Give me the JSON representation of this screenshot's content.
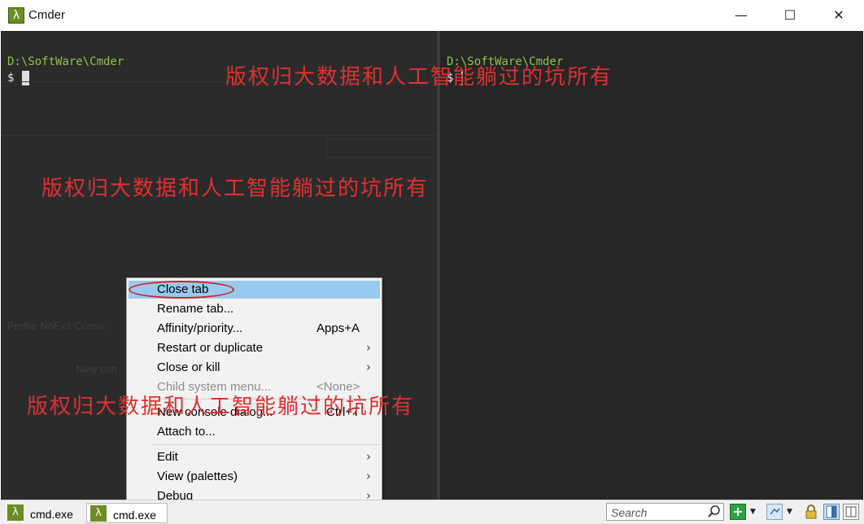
{
  "window": {
    "title": "Cmder",
    "app_icon_glyph": "λ",
    "buttons": {
      "minimize": "—",
      "maximize": "☐",
      "close": "✕"
    }
  },
  "consoles": {
    "left": {
      "path": "D:\\SoftWare\\Cmder",
      "prompt": "$"
    },
    "right": {
      "path": "D:\\SoftWare\\Cmder",
      "prompt": "$"
    }
  },
  "ghost_text": {
    "row1": "Profile   NoExit   Conso",
    "row2": "New con"
  },
  "watermarks": {
    "wm1": "版权归大数据和人工智能躺过的坑所有",
    "wm2": "版权归大数据和人工智能躺过的坑所有",
    "wm3": "版权归大数据和人工智能躺过的坑所有"
  },
  "context_menu": {
    "items": [
      {
        "label": "Close tab",
        "shortcut": "",
        "submenu": false
      },
      {
        "label": "Rename tab...",
        "shortcut": "",
        "submenu": false
      },
      {
        "label": "Affinity/priority...",
        "shortcut": "Apps+A",
        "submenu": false
      },
      {
        "label": "Restart or duplicate",
        "shortcut": "",
        "submenu": true
      },
      {
        "label": "Close or kill",
        "shortcut": "",
        "submenu": true
      },
      {
        "label": "Child system menu...",
        "shortcut": "<None>",
        "submenu": false
      },
      {
        "label": "New console dialog...",
        "shortcut": "Ctrl+T",
        "submenu": false
      },
      {
        "label": "Attach to...",
        "shortcut": "",
        "submenu": false
      },
      {
        "label": "Edit",
        "shortcut": "",
        "submenu": true
      },
      {
        "label": "View (palettes)",
        "shortcut": "",
        "submenu": true
      },
      {
        "label": "Debug",
        "shortcut": "",
        "submenu": true
      }
    ],
    "submenu_arrow": "›"
  },
  "statusbar": {
    "tabs": [
      {
        "label": "cmd.exe",
        "icon": "λ"
      },
      {
        "label": "cmd.exe",
        "icon": "λ"
      }
    ],
    "search_placeholder": "Search",
    "new_console_glyph": "+",
    "dropdown_glyph": "▼"
  },
  "colors": {
    "console_bg": "#2b2b2b",
    "path_green": "#8bc34a",
    "menu_highlight": "#99c9ef",
    "watermark_red": "#e03030",
    "annotation_red": "#d61f1f"
  }
}
